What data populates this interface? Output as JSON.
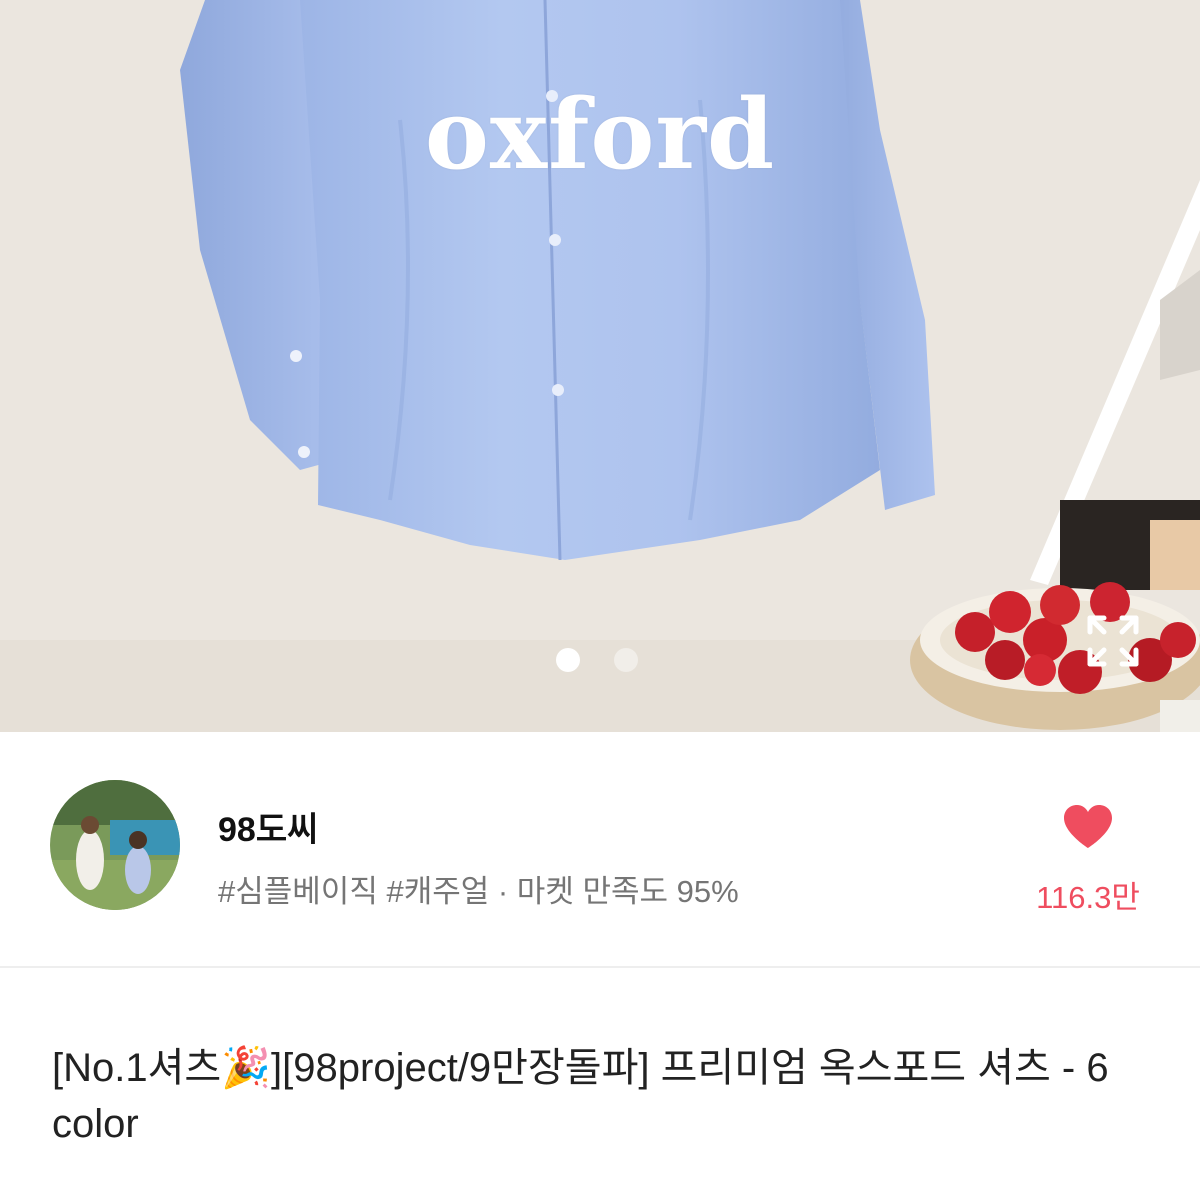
{
  "hero": {
    "overlay_text": "oxford",
    "slide_count": 2,
    "active_slide": 1,
    "expand_icon": "expand-icon"
  },
  "seller": {
    "name": "98도씨",
    "tags": "#심플베이직 #캐주얼 · 마켓 만족도 95%",
    "like_count": "116.3만",
    "heart_icon": "heart-icon"
  },
  "product": {
    "title_line1": "[No.1셔츠",
    "title_emoji": "🎉",
    "title_rest": "][98project/9만장돌파] 프리미엄 옥스포드 셔츠 - 6 color"
  },
  "colors": {
    "accent": "#ef4d5f",
    "shirt": "#a9c2ee",
    "background": "#ebe6df"
  }
}
